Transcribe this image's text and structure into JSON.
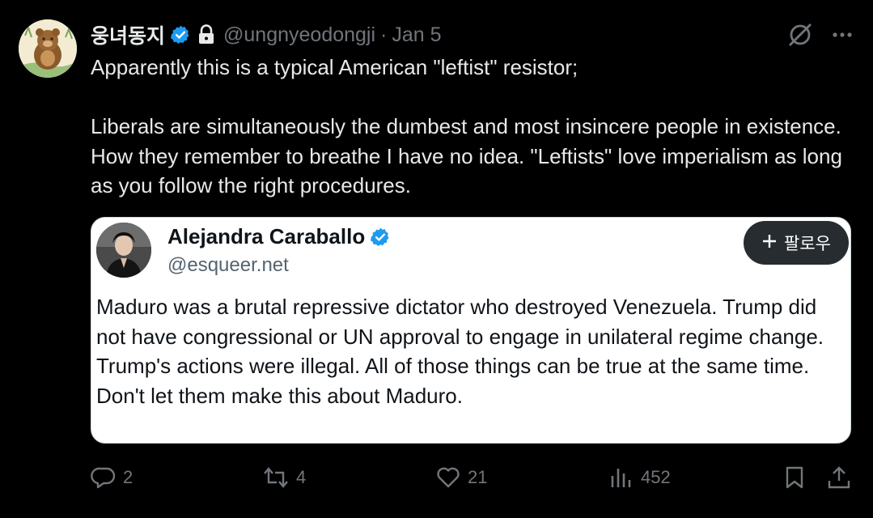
{
  "tweet": {
    "display_name": "웅녀동지",
    "handle": "@ungnyeodongji",
    "separator": "·",
    "date": "Jan 5",
    "paragraph1": "Apparently this is a typical American \"leftist\" resistor;",
    "paragraph2": "Liberals are simultaneously the dumbest and most insincere people in existence. How they remember to breathe I have no idea.  \"Leftists\" love imperialism as long as you follow the right procedures."
  },
  "quote": {
    "display_name": "Alejandra Caraballo",
    "handle": "@esqueer.net",
    "follow_label": "팔로우",
    "text": "Maduro was a brutal repressive dictator who destroyed Venezuela. Trump did not have congressional or UN approval to engage in unilateral regime change. Trump's actions were illegal. All of those things can be true at the same time. Don't let them make this about Maduro."
  },
  "actions": {
    "replies": "2",
    "reposts": "4",
    "likes": "21",
    "views": "452"
  },
  "icons": {
    "verified": "verified-badge-icon",
    "lock": "lock-icon",
    "grok": "grok-icon",
    "more": "more-icon",
    "reply": "reply-icon",
    "repost": "repost-icon",
    "like": "like-icon",
    "views": "views-icon",
    "bookmark": "bookmark-icon",
    "share": "share-icon"
  },
  "colors": {
    "background": "#000000",
    "text": "#e7e9ea",
    "muted": "#71767b",
    "verified": "#1d9bf0"
  }
}
